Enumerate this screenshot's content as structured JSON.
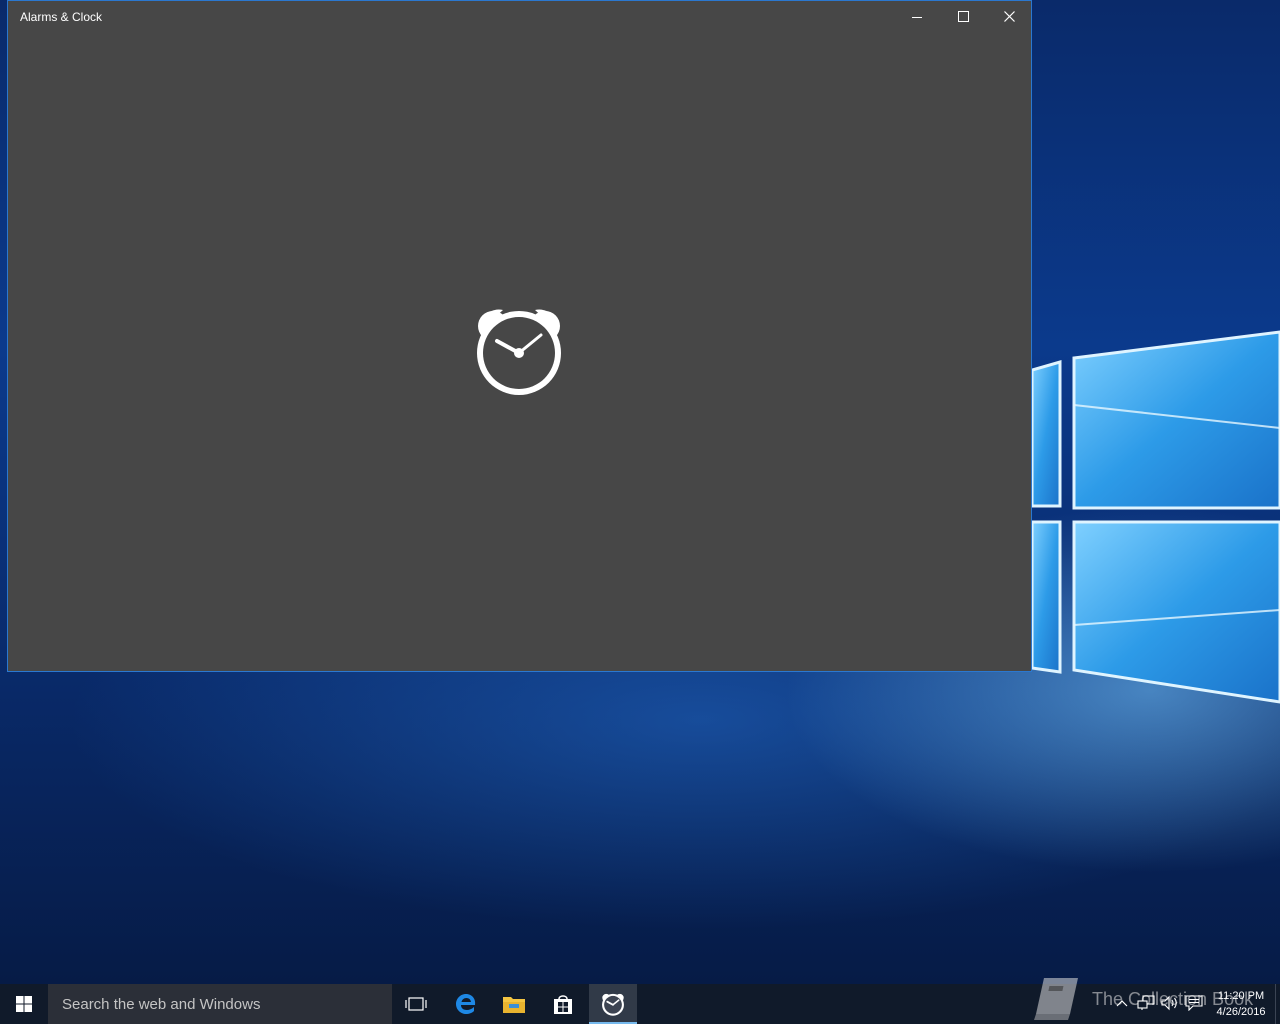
{
  "window": {
    "title": "Alarms & Clock",
    "icons": {
      "minimize": "minimize-icon",
      "maximize": "maximize-icon",
      "close": "close-icon",
      "splash": "alarm-clock-icon"
    }
  },
  "taskbar": {
    "search_placeholder": "Search the web and Windows",
    "icons": [
      "windows-start-icon",
      "task-view-icon",
      "edge-icon",
      "file-explorer-icon",
      "store-icon",
      "alarm-clock-icon"
    ],
    "tray": {
      "icons": [
        "chevron-up-icon",
        "network-icon",
        "volume-icon",
        "action-center-icon"
      ],
      "time": "11:20 PM",
      "date": "4/26/2016"
    }
  },
  "watermark": {
    "text": "The Collection Book",
    "icon": "book-icon"
  },
  "colors": {
    "window_bg": "#474747",
    "window_border": "#2b78d0",
    "taskbar_bg": "#101a2a",
    "accent": "#76b9ed"
  }
}
